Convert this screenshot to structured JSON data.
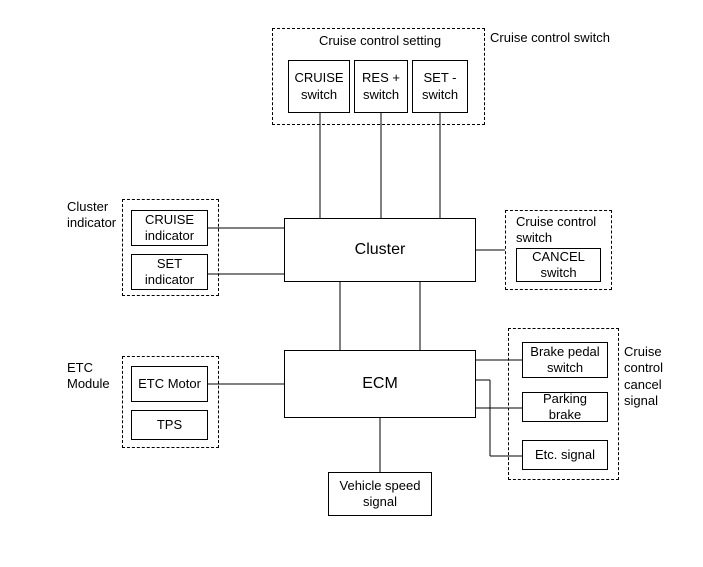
{
  "top_label": "Cruise control switch",
  "cruise_setting": {
    "title": "Cruise control setting",
    "cruise": "CRUISE\nswitch",
    "res": "RES +\nswitch",
    "set": "SET -\nswitch"
  },
  "cluster_indicator": {
    "title": "Cluster\nindicator",
    "cruise": "CRUISE\nindicator",
    "set": "SET\nindicator"
  },
  "cluster": "Cluster",
  "cancel_group": {
    "title": "Cruise control\nswitch",
    "cancel": "CANCEL\nswitch"
  },
  "etc_module": {
    "title": "ETC\nModule",
    "motor": "ETC\nMotor",
    "tps": "TPS"
  },
  "ecm": "ECM",
  "cancel_signals": {
    "title": "Cruise\ncontrol\ncancel\nsignal",
    "brake": "Brake pedal\nswitch",
    "parking": "Parking brake",
    "etc": "Etc. signal"
  },
  "vehicle_speed": "Vehicle speed\nsignal"
}
